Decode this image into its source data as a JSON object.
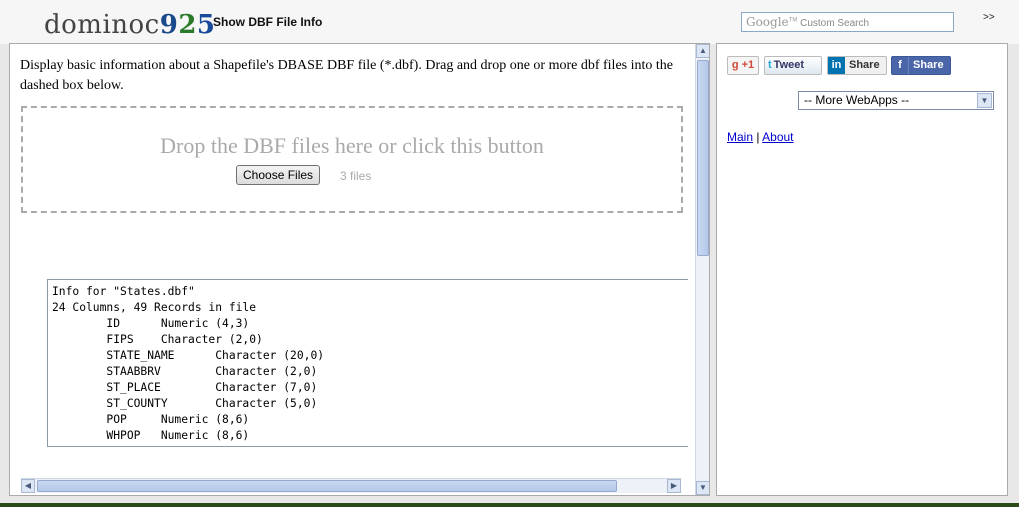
{
  "header": {
    "logo_prefix": "dominoc",
    "logo_digits": [
      "9",
      "2",
      "5"
    ],
    "app_title": "Show DBF File Info",
    "search_brand": "Google",
    "search_placeholder": "Custom Search",
    "expand_label": ">>"
  },
  "main": {
    "description": "Display basic information about a Shapefile's DBASE DBF file (*.dbf). Drag and drop one or more dbf files into the dashed box below.",
    "dropzone_text": "Drop the DBF files here or click this button",
    "choose_button": "Choose Files",
    "file_count": "3 files",
    "info_text": "Info for \"States.dbf\"\n24 Columns, 49 Records in file\n        ID      Numeric (4,3)\n        FIPS    Character (2,0)\n        STATE_NAME      Character (20,0)\n        STAABBRV        Character (2,0)\n        ST_PLACE        Character (7,0)\n        ST_COUNTY       Character (5,0)\n        POP     Numeric (8,6)\n        WHPOP   Numeric (8,6)"
  },
  "scrollbars": {
    "up": "▲",
    "down": "▼",
    "left": "◀",
    "right": "▶"
  },
  "sidebar": {
    "gplus": "+1",
    "tweet": "Tweet",
    "linkedin": "Share",
    "facebook": "Share",
    "webapps_select": "-- More WebApps --",
    "link_main": "Main",
    "link_sep": "|",
    "link_about": "About"
  },
  "icons": {
    "gplus_icon": "g",
    "twitter_icon": "t",
    "linkedin_icon": "in",
    "facebook_icon": "f",
    "dropdown_arrow": "▼"
  },
  "colors": {
    "gplus": "#d14836",
    "twitter": "#2aa9e0",
    "linkedin": "#0073b1",
    "facebook": "#4a66a8",
    "link": "#0000cc"
  }
}
